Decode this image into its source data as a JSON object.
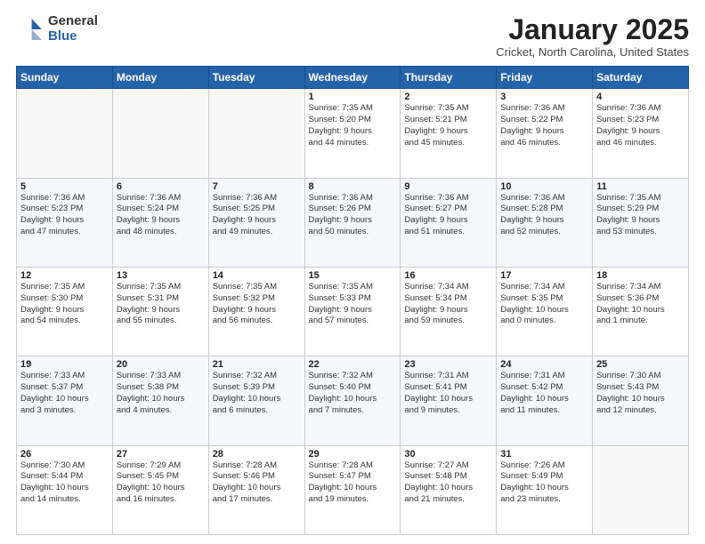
{
  "logo": {
    "general": "General",
    "blue": "Blue"
  },
  "header": {
    "month_year": "January 2025",
    "location": "Cricket, North Carolina, United States"
  },
  "days_of_week": [
    "Sunday",
    "Monday",
    "Tuesday",
    "Wednesday",
    "Thursday",
    "Friday",
    "Saturday"
  ],
  "weeks": [
    [
      {
        "day": "",
        "info": ""
      },
      {
        "day": "",
        "info": ""
      },
      {
        "day": "",
        "info": ""
      },
      {
        "day": "1",
        "info": "Sunrise: 7:35 AM\nSunset: 5:20 PM\nDaylight: 9 hours\nand 44 minutes."
      },
      {
        "day": "2",
        "info": "Sunrise: 7:35 AM\nSunset: 5:21 PM\nDaylight: 9 hours\nand 45 minutes."
      },
      {
        "day": "3",
        "info": "Sunrise: 7:36 AM\nSunset: 5:22 PM\nDaylight: 9 hours\nand 46 minutes."
      },
      {
        "day": "4",
        "info": "Sunrise: 7:36 AM\nSunset: 5:23 PM\nDaylight: 9 hours\nand 46 minutes."
      }
    ],
    [
      {
        "day": "5",
        "info": "Sunrise: 7:36 AM\nSunset: 5:23 PM\nDaylight: 9 hours\nand 47 minutes."
      },
      {
        "day": "6",
        "info": "Sunrise: 7:36 AM\nSunset: 5:24 PM\nDaylight: 9 hours\nand 48 minutes."
      },
      {
        "day": "7",
        "info": "Sunrise: 7:36 AM\nSunset: 5:25 PM\nDaylight: 9 hours\nand 49 minutes."
      },
      {
        "day": "8",
        "info": "Sunrise: 7:36 AM\nSunset: 5:26 PM\nDaylight: 9 hours\nand 50 minutes."
      },
      {
        "day": "9",
        "info": "Sunrise: 7:36 AM\nSunset: 5:27 PM\nDaylight: 9 hours\nand 51 minutes."
      },
      {
        "day": "10",
        "info": "Sunrise: 7:36 AM\nSunset: 5:28 PM\nDaylight: 9 hours\nand 52 minutes."
      },
      {
        "day": "11",
        "info": "Sunrise: 7:35 AM\nSunset: 5:29 PM\nDaylight: 9 hours\nand 53 minutes."
      }
    ],
    [
      {
        "day": "12",
        "info": "Sunrise: 7:35 AM\nSunset: 5:30 PM\nDaylight: 9 hours\nand 54 minutes."
      },
      {
        "day": "13",
        "info": "Sunrise: 7:35 AM\nSunset: 5:31 PM\nDaylight: 9 hours\nand 55 minutes."
      },
      {
        "day": "14",
        "info": "Sunrise: 7:35 AM\nSunset: 5:32 PM\nDaylight: 9 hours\nand 56 minutes."
      },
      {
        "day": "15",
        "info": "Sunrise: 7:35 AM\nSunset: 5:33 PM\nDaylight: 9 hours\nand 57 minutes."
      },
      {
        "day": "16",
        "info": "Sunrise: 7:34 AM\nSunset: 5:34 PM\nDaylight: 9 hours\nand 59 minutes."
      },
      {
        "day": "17",
        "info": "Sunrise: 7:34 AM\nSunset: 5:35 PM\nDaylight: 10 hours\nand 0 minutes."
      },
      {
        "day": "18",
        "info": "Sunrise: 7:34 AM\nSunset: 5:36 PM\nDaylight: 10 hours\nand 1 minute."
      }
    ],
    [
      {
        "day": "19",
        "info": "Sunrise: 7:33 AM\nSunset: 5:37 PM\nDaylight: 10 hours\nand 3 minutes."
      },
      {
        "day": "20",
        "info": "Sunrise: 7:33 AM\nSunset: 5:38 PM\nDaylight: 10 hours\nand 4 minutes."
      },
      {
        "day": "21",
        "info": "Sunrise: 7:32 AM\nSunset: 5:39 PM\nDaylight: 10 hours\nand 6 minutes."
      },
      {
        "day": "22",
        "info": "Sunrise: 7:32 AM\nSunset: 5:40 PM\nDaylight: 10 hours\nand 7 minutes."
      },
      {
        "day": "23",
        "info": "Sunrise: 7:31 AM\nSunset: 5:41 PM\nDaylight: 10 hours\nand 9 minutes."
      },
      {
        "day": "24",
        "info": "Sunrise: 7:31 AM\nSunset: 5:42 PM\nDaylight: 10 hours\nand 11 minutes."
      },
      {
        "day": "25",
        "info": "Sunrise: 7:30 AM\nSunset: 5:43 PM\nDaylight: 10 hours\nand 12 minutes."
      }
    ],
    [
      {
        "day": "26",
        "info": "Sunrise: 7:30 AM\nSunset: 5:44 PM\nDaylight: 10 hours\nand 14 minutes."
      },
      {
        "day": "27",
        "info": "Sunrise: 7:29 AM\nSunset: 5:45 PM\nDaylight: 10 hours\nand 16 minutes."
      },
      {
        "day": "28",
        "info": "Sunrise: 7:28 AM\nSunset: 5:46 PM\nDaylight: 10 hours\nand 17 minutes."
      },
      {
        "day": "29",
        "info": "Sunrise: 7:28 AM\nSunset: 5:47 PM\nDaylight: 10 hours\nand 19 minutes."
      },
      {
        "day": "30",
        "info": "Sunrise: 7:27 AM\nSunset: 5:48 PM\nDaylight: 10 hours\nand 21 minutes."
      },
      {
        "day": "31",
        "info": "Sunrise: 7:26 AM\nSunset: 5:49 PM\nDaylight: 10 hours\nand 23 minutes."
      },
      {
        "day": "",
        "info": ""
      }
    ]
  ]
}
